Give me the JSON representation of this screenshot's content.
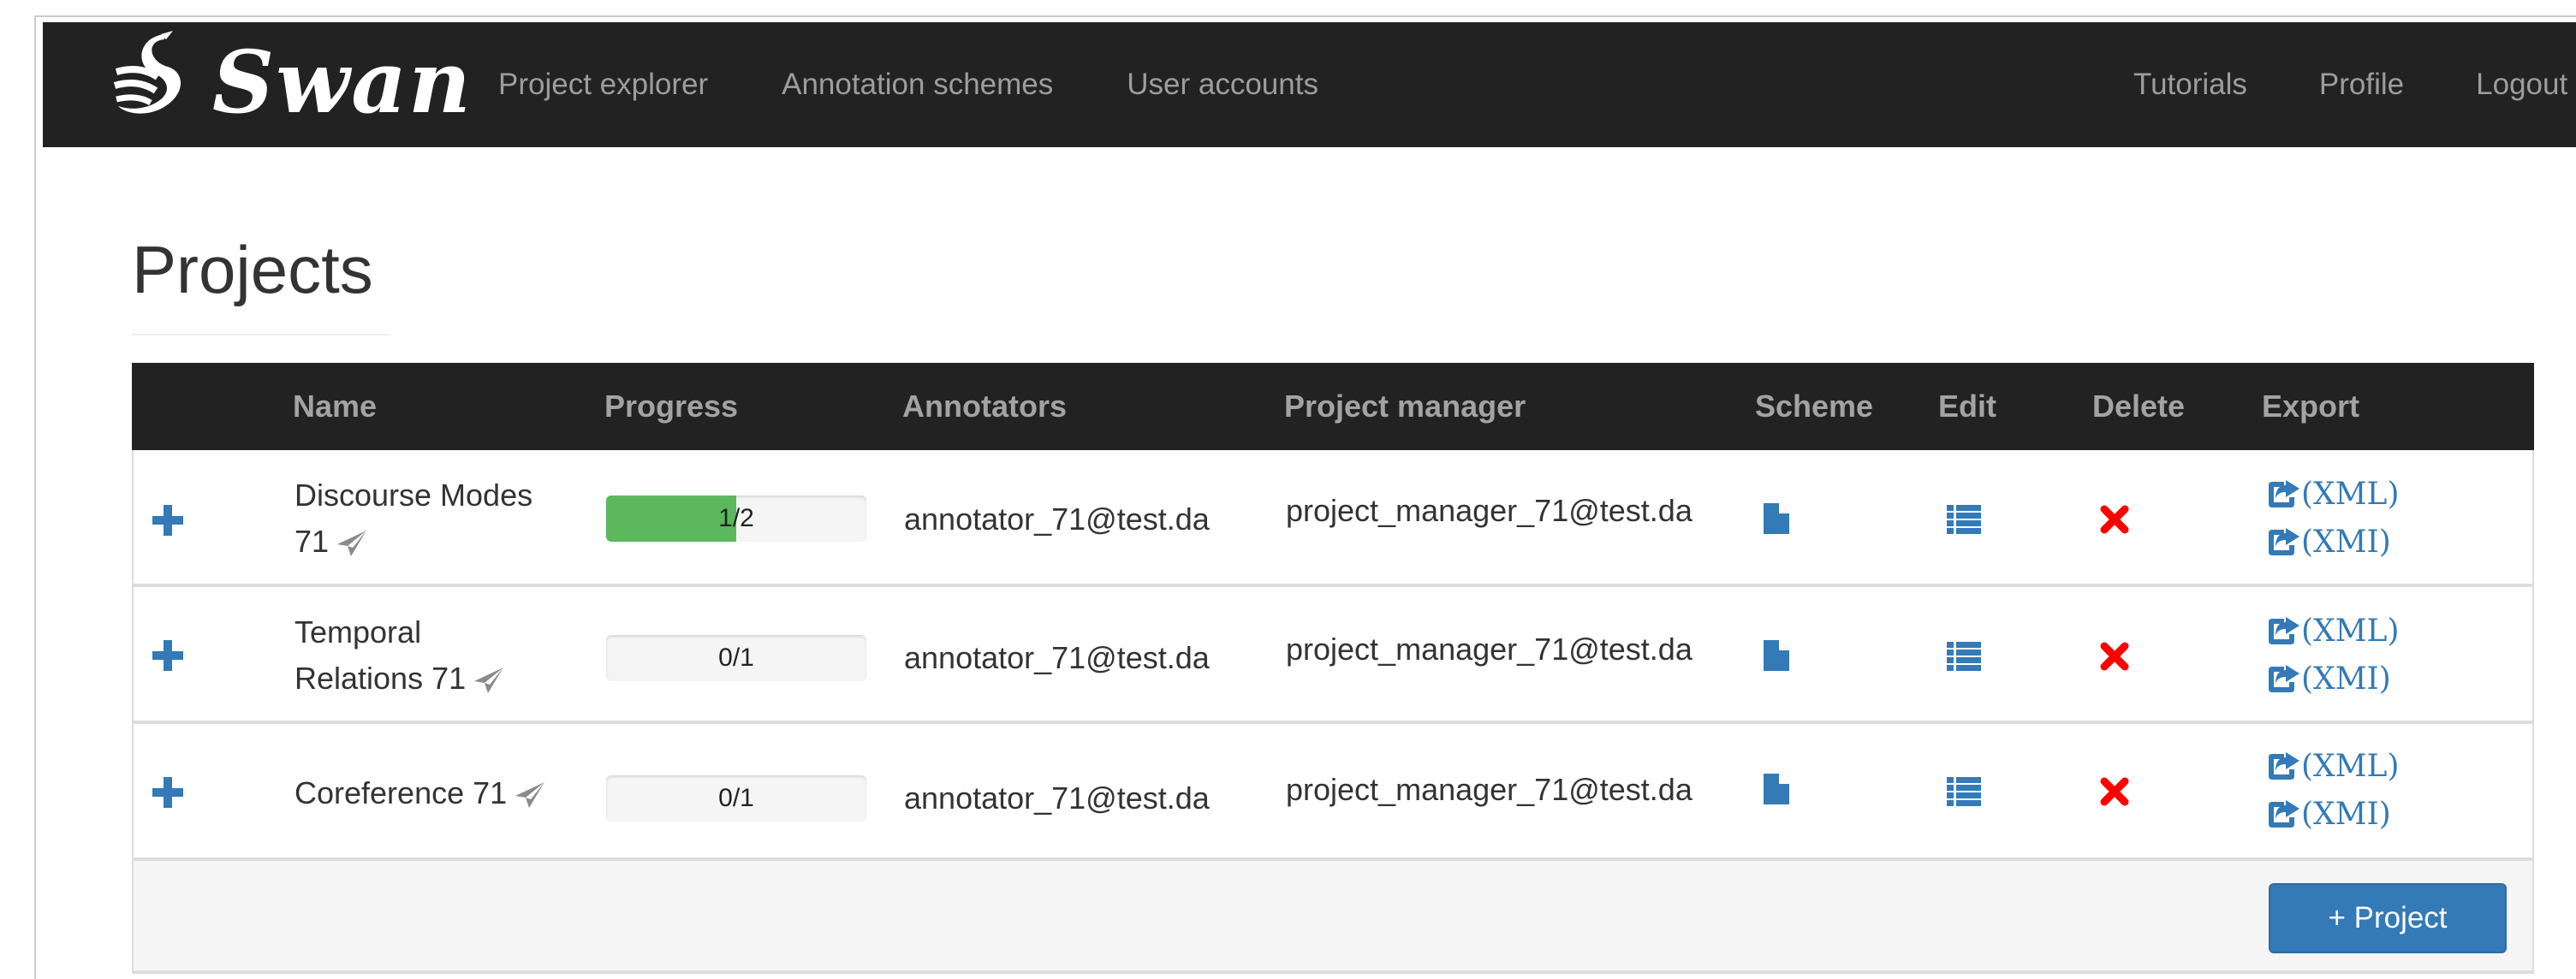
{
  "navbar": {
    "brand": "Swan",
    "left_links": [
      {
        "label": "Project explorer"
      },
      {
        "label": "Annotation schemes"
      },
      {
        "label": "User accounts"
      }
    ],
    "right_links": [
      {
        "label": "Tutorials"
      },
      {
        "label": "Profile"
      },
      {
        "label": "Logout"
      }
    ]
  },
  "page": {
    "title": "Projects"
  },
  "table": {
    "headers": [
      "",
      "Name",
      "Progress",
      "Annotators",
      "Project manager",
      "Scheme",
      "Edit",
      "Delete",
      "Export"
    ],
    "rows": [
      {
        "name_line1": "Discourse Modes",
        "name_line2": "71",
        "progress_label": "1/2",
        "progress_fraction": 0.5,
        "annotators": "annotator_71@test.da",
        "project_manager": "project_manager_71@test.da",
        "export_xml": "(XML)",
        "export_xmi": "(XMI)"
      },
      {
        "name_line1": "Temporal",
        "name_line2": "Relations 71",
        "progress_label": "0/1",
        "progress_fraction": 0,
        "annotators": "annotator_71@test.da",
        "project_manager": "project_manager_71@test.da",
        "export_xml": "(XML)",
        "export_xmi": "(XMI)"
      },
      {
        "name_line1": "Coreference 71",
        "name_line2": "",
        "progress_label": "0/1",
        "progress_fraction": 0,
        "annotators": "annotator_71@test.da",
        "project_manager": "project_manager_71@test.da",
        "export_xml": "(XML)",
        "export_xmi": "(XMI)"
      }
    ],
    "add_project_label": "+ Project"
  },
  "icons": {
    "expand": "plus-icon",
    "share": "paper-plane-icon",
    "scheme": "file-icon",
    "edit": "list-icon",
    "delete": "remove-icon",
    "export": "share-icon"
  },
  "colors": {
    "navbar_bg": "#222222",
    "link_blue": "#337ab7",
    "progress_green": "#5cb85c",
    "delete_red": "#ff0000"
  }
}
